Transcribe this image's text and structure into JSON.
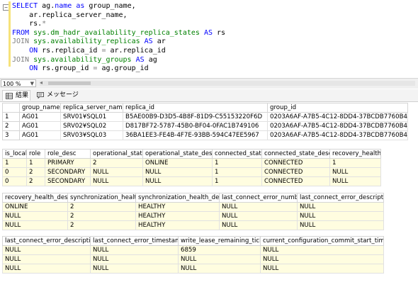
{
  "editor": {
    "code_lines": [
      [
        {
          "t": "SELECT ",
          "c": "kw"
        },
        {
          "t": "ag.",
          "c": "id"
        },
        {
          "t": "name",
          "c": "kw"
        },
        {
          "t": " as ",
          "c": "kw"
        },
        {
          "t": "group_name,",
          "c": "id"
        }
      ],
      [
        {
          "t": "    ar.replica_server_name,",
          "c": "id"
        }
      ],
      [
        {
          "t": "    rs.",
          "c": "id"
        },
        {
          "t": "*",
          "c": "op"
        }
      ],
      [
        {
          "t": "FROM ",
          "c": "kw"
        },
        {
          "t": "sys.dm_hadr_availability_replica_states",
          "c": "fn"
        },
        {
          "t": " AS ",
          "c": "kw"
        },
        {
          "t": "rs",
          "c": "id"
        }
      ],
      [
        {
          "t": "JOIN ",
          "c": "op"
        },
        {
          "t": "sys.availability_replicas",
          "c": "fn"
        },
        {
          "t": " AS ",
          "c": "kw"
        },
        {
          "t": "ar",
          "c": "id"
        }
      ],
      [
        {
          "t": "    ON ",
          "c": "kw"
        },
        {
          "t": "rs.replica_id ",
          "c": "id"
        },
        {
          "t": "=",
          "c": "op"
        },
        {
          "t": " ar.replica_id",
          "c": "id"
        }
      ],
      [
        {
          "t": "JOIN ",
          "c": "op"
        },
        {
          "t": "sys.availability_groups",
          "c": "fn"
        },
        {
          "t": " AS ",
          "c": "kw"
        },
        {
          "t": "ag",
          "c": "id"
        }
      ],
      [
        {
          "t": "    ON ",
          "c": "kw"
        },
        {
          "t": "rs.group_id ",
          "c": "id"
        },
        {
          "t": "=",
          "c": "op"
        },
        {
          "t": " ag.group_id",
          "c": "id"
        }
      ]
    ],
    "fold_glyph": "−"
  },
  "status": {
    "zoom": "100 %"
  },
  "tabs": [
    {
      "label": "結果",
      "icon": "grid-icon"
    },
    {
      "label": "メッセージ",
      "icon": "message-icon"
    }
  ],
  "grids": [
    {
      "row_numbers": true,
      "columns": [
        "group_name",
        "replica_server_name",
        "replica_id",
        "group_id"
      ],
      "rows": [
        [
          "AG01",
          "SRV01¥SQL01",
          "B5AE00B9-D3D5-4B8F-81D9-C55153220F6D",
          "0203A6AF-A7B5-4C12-8DD4-37BCDB7760B4"
        ],
        [
          "AG01",
          "SRV02¥SQL02",
          "D817BF72-5787-45B0-BF04-0FAC1B749106",
          "0203A6AF-A7B5-4C12-8DD4-37BCDB7760B4"
        ],
        [
          "AG01",
          "SRV03¥SQL03",
          "36BA1EE3-FE4B-4F7E-93BB-594C47EE5967",
          "0203A6AF-A7B5-4C12-8DD4-37BCDB7760B4"
        ]
      ]
    },
    {
      "row_numbers": false,
      "columns": [
        "is_local",
        "role",
        "role_desc",
        "operational_state",
        "operational_state_desc",
        "connected_state",
        "connected_state_desc",
        "recovery_health"
      ],
      "rows": [
        [
          "1",
          "1",
          "PRIMARY",
          "2",
          "ONLINE",
          "1",
          "CONNECTED",
          "1"
        ],
        [
          "0",
          "2",
          "SECONDARY",
          "NULL",
          "NULL",
          "1",
          "CONNECTED",
          "NULL"
        ],
        [
          "0",
          "2",
          "SECONDARY",
          "NULL",
          "NULL",
          "1",
          "CONNECTED",
          "NULL"
        ]
      ]
    },
    {
      "row_numbers": false,
      "columns": [
        "recovery_health_desc",
        "synchronization_health",
        "synchronization_health_desc",
        "last_connect_error_number",
        "last_connect_error_description"
      ],
      "rows": [
        [
          "ONLINE",
          "2",
          "HEALTHY",
          "NULL",
          "NULL"
        ],
        [
          "NULL",
          "2",
          "HEALTHY",
          "NULL",
          "NULL"
        ],
        [
          "NULL",
          "2",
          "HEALTHY",
          "NULL",
          "NULL"
        ]
      ]
    },
    {
      "row_numbers": false,
      "columns": [
        "last_connect_error_description",
        "last_connect_error_timestamp",
        "write_lease_remaining_ticks",
        "current_configuration_commit_start_time_utc"
      ],
      "rows": [
        [
          "NULL",
          "NULL",
          "6859",
          "NULL"
        ],
        [
          "NULL",
          "NULL",
          "NULL",
          "NULL"
        ],
        [
          "NULL",
          "NULL",
          "NULL",
          "NULL"
        ]
      ]
    }
  ],
  "colors": {
    "keyword": "#0000ff",
    "system_object": "#008000",
    "operator": "#808080",
    "null_cell": "#fffde0"
  }
}
